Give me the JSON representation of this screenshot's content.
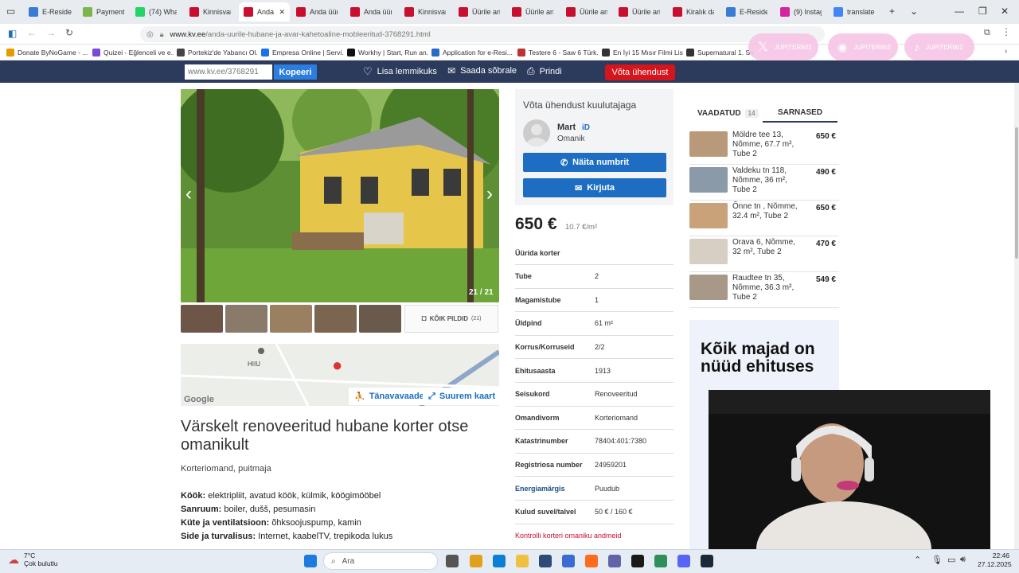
{
  "browser": {
    "tabs": [
      {
        "label": "E-Resident",
        "color": "#3a7bd5"
      },
      {
        "label": "Payment",
        "color": "#7ab648"
      },
      {
        "label": "(74) Whats",
        "color": "#25d366"
      },
      {
        "label": "Kinnisvara",
        "color": "#c8102e"
      },
      {
        "label": "Anda ül",
        "color": "#c8102e"
      },
      {
        "label": "Anda üüril",
        "color": "#c8102e"
      },
      {
        "label": "Anda üüril",
        "color": "#c8102e"
      },
      {
        "label": "Kinnisvara",
        "color": "#c8102e"
      },
      {
        "label": "Üürile and",
        "color": "#c8102e"
      },
      {
        "label": "Üürile and",
        "color": "#c8102e"
      },
      {
        "label": "Üürile and",
        "color": "#c8102e"
      },
      {
        "label": "Üürile and",
        "color": "#c8102e"
      },
      {
        "label": "Kiralık daiı",
        "color": "#c8102e"
      },
      {
        "label": "E-Resident",
        "color": "#3a7bd5"
      },
      {
        "label": "(9) Instagr",
        "color": "#d6249f"
      },
      {
        "label": "translate",
        "color": "#4285f4"
      }
    ],
    "url_domain": "www.kv.ee",
    "url_path": "/anda-uurile-hubane-ja-avar-kahetoaline-mobleeritud-3768291.html",
    "bookmarks": [
      "Donate ByNoGame - ...",
      "Quizei - Eğlenceli ve e...",
      "Portekiz'de Yabancı Ol...",
      "Empresa Online | Servi...",
      "Workhy | Start, Run an...",
      "Application for e-Resi...",
      "Testere 6 - Saw 6 Türk...",
      "En İyi 15 Mısır Filmi Lis...",
      "Supernatural 1. Se"
    ],
    "social_overlay": [
      "JUPITER902",
      "JUPITER902",
      "JUPITER902"
    ]
  },
  "sitenav": {
    "link_value": "www.kv.ee/3768291",
    "copy_label": "Kopeeri",
    "favorite_label": "Lisa lemmikuks",
    "send_label": "Saada sõbrale",
    "print_label": "Prindi",
    "contact_label": "Võta ühendust"
  },
  "gallery": {
    "counter": "21 / 21",
    "all_pictures_label": "KÕIK PILDID",
    "all_pictures_count": "(21)"
  },
  "map": {
    "district": "HIIU",
    "provider": "Google",
    "street_view_label": "Tänavavaade",
    "bigger_map_label": "Suurem kaart"
  },
  "listing": {
    "title": "Värskelt renoveeritud hubane korter otse omanikult",
    "subtitle": "Korteriomand, puitmaja",
    "features": [
      {
        "key": "Köök:",
        "value": "elektripliit, avatud köök, külmik, köögimööbel"
      },
      {
        "key": "Sanruum:",
        "value": "boiler, dušš, pesumasin"
      },
      {
        "key": "Küte ja ventilatsioon:",
        "value": "õhksoojuspump, kamin"
      },
      {
        "key": "Side ja turvalisus:",
        "value": "Internet, kaabelTV, trepikoda lukus"
      }
    ]
  },
  "contact": {
    "heading": "Võta ühendust kuulutajaga",
    "name": "Mart",
    "id_badge": "iD",
    "role": "Omanik",
    "show_number_label": "Näita numbrit",
    "write_label": "Kirjuta"
  },
  "price": {
    "amount": "650 €",
    "per_m2": "10.7 €/m²"
  },
  "properties": [
    {
      "key": "Üürida korter",
      "value": ""
    },
    {
      "key": "Tube",
      "value": "2"
    },
    {
      "key": "Magamistube",
      "value": "1"
    },
    {
      "key": "Üldpind",
      "value": "61 m²"
    },
    {
      "key": "Korrus/Korruseid",
      "value": "2/2"
    },
    {
      "key": "Ehitusaasta",
      "value": "1913"
    },
    {
      "key": "Seisukord",
      "value": "Renoveeritud"
    },
    {
      "key": "Omandivorm",
      "value": "Korteriomand"
    },
    {
      "key": "Katastrinumber",
      "value": "78404:401:7380"
    },
    {
      "key": "Registriosa number",
      "value": "24959201"
    },
    {
      "key": "Energiamärgis",
      "value": "Puudub"
    },
    {
      "key": "Kulud suvel/talvel",
      "value": "50 € / 160 €"
    }
  ],
  "owner_link": "Kontrolli korteri omaniku andmeid",
  "sidebar": {
    "tab_viewed": "VAADATUD",
    "tab_viewed_count": "14",
    "tab_similar": "SARNASED",
    "similar": [
      {
        "text": "Möldre tee 13, Nõmme, 67.7 m², Tube 2",
        "price": "650 €",
        "color": "#b89a7a"
      },
      {
        "text": "Valdeku tn 118, Nõmme, 36 m², Tube 2",
        "price": "490 €",
        "color": "#8a9aa8"
      },
      {
        "text": "Õnne tn , Nõmme, 32.4 m², Tube 2",
        "price": "650 €",
        "color": "#c9a27a"
      },
      {
        "text": "Orava 6, Nõmme, 32 m², Tube 2",
        "price": "470 €",
        "color": "#d8cfc4"
      },
      {
        "text": "Raudtee tn 35, Nõmme, 36.3 m², Tube 2",
        "price": "549 €",
        "color": "#a89888"
      }
    ],
    "ad_text": "Kõik majad on nüüd ehituses"
  },
  "taskbar": {
    "temperature": "7°C",
    "weather": "Çok bulutlu",
    "search_placeholder": "Ara",
    "time": "22:46",
    "date": "27.12.2025"
  }
}
